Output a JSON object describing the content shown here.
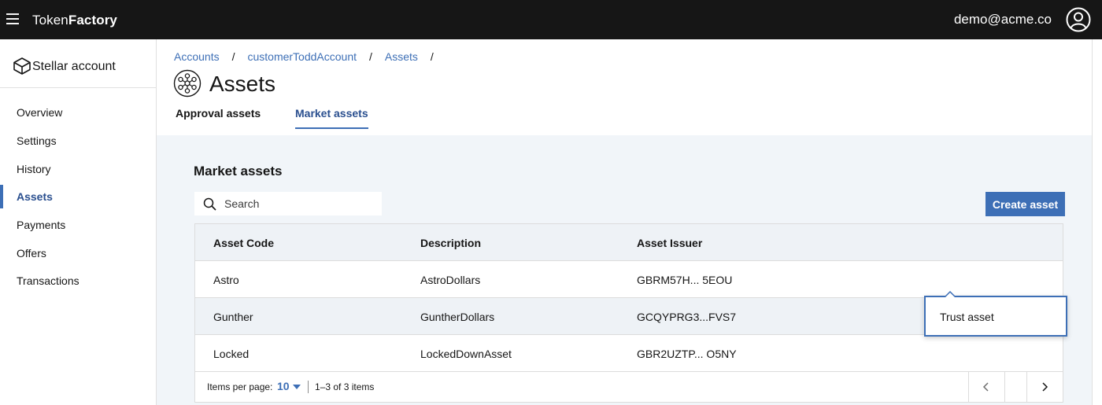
{
  "topbar": {
    "brand_light": "Token",
    "brand_bold": "Factory",
    "user_email": "demo@acme.co"
  },
  "sidenav": {
    "title": "Stellar account",
    "items": [
      {
        "label": "Overview"
      },
      {
        "label": "Settings"
      },
      {
        "label": "History"
      },
      {
        "label": "Assets",
        "active": true
      },
      {
        "label": "Payments"
      },
      {
        "label": "Offers"
      },
      {
        "label": "Transactions"
      }
    ]
  },
  "breadcrumb": [
    "Accounts",
    "customerToddAccount",
    "Assets"
  ],
  "breadcrumb_separator": "/",
  "page": {
    "title": "Assets",
    "tabs": [
      {
        "label": "Approval assets",
        "active": false
      },
      {
        "label": "Market assets",
        "active": true
      }
    ]
  },
  "section": {
    "title": "Market assets",
    "search_placeholder": "Search",
    "create_button": "Create asset"
  },
  "table": {
    "headers": [
      "Asset Code",
      "Description",
      "Asset Issuer"
    ],
    "rows": [
      [
        "Astro",
        "AstroDollars",
        "GBRM57H... 5EOU"
      ],
      [
        "Gunther",
        "GuntherDollars",
        "GCQYPRG3...FVS7"
      ],
      [
        "Locked",
        "LockedDownAsset",
        "GBR2UZTP... O5NY"
      ]
    ],
    "highlighted_row": 1
  },
  "pagination": {
    "items_per_page_label": "Items per page:",
    "items_per_page_value": "10",
    "range_text": "1–3 of 3 items"
  },
  "popover": {
    "item": "Trust asset"
  },
  "colors": {
    "accent": "#3d6fb6",
    "topbar": "#161616",
    "panel_bg": "#f1f5f9"
  }
}
